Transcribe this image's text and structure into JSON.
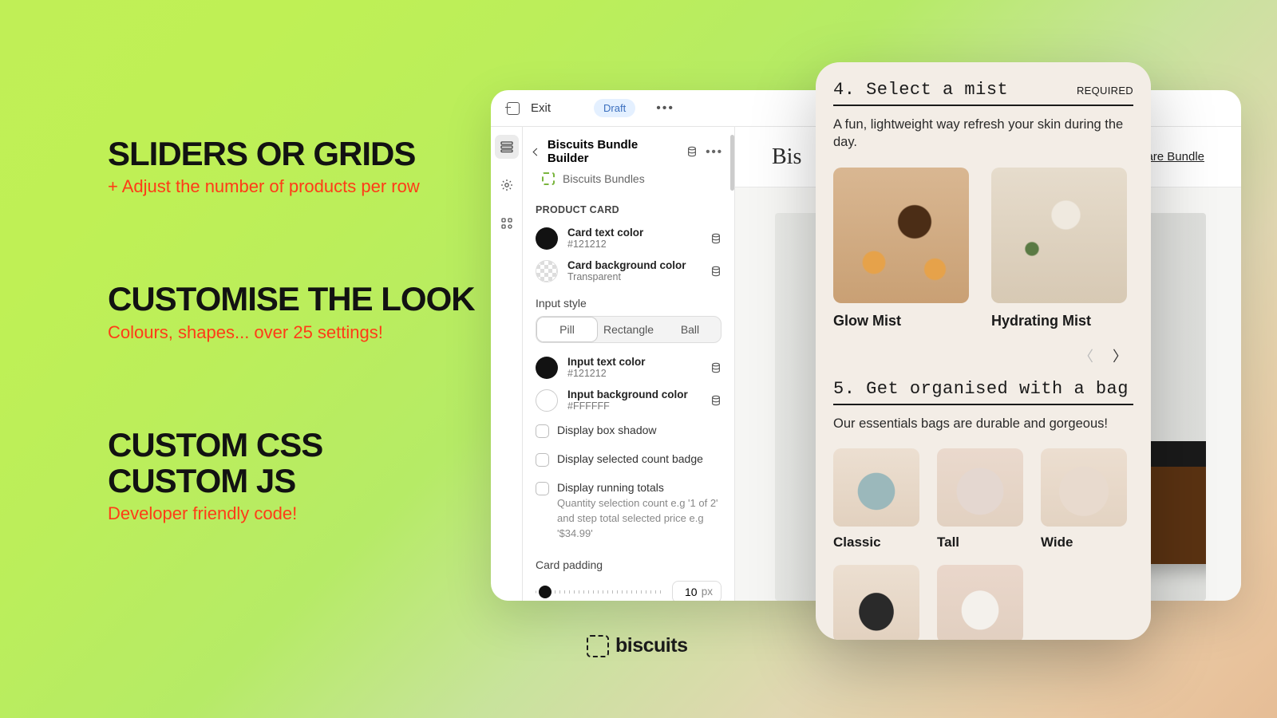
{
  "headlines": [
    {
      "title": "SLIDERS OR GRIDS",
      "sub": "+ Adjust the number of products per row"
    },
    {
      "title": "CUSTOMISE THE LOOK",
      "sub": "Colours, shapes... over 25 settings!"
    },
    {
      "title": "CUSTOM CSS\nCUSTOM JS",
      "sub": "Developer friendly code!"
    }
  ],
  "editor": {
    "exit": "Exit",
    "status": "Draft",
    "breadcrumb": "Biscuits Bundle Builder",
    "app": "Biscuits Bundles",
    "section": "PRODUCT CARD",
    "cardTextColor": {
      "name": "Card text color",
      "val": "#121212"
    },
    "cardBgColor": {
      "name": "Card background color",
      "val": "Transparent"
    },
    "inputStyle": {
      "label": "Input style",
      "options": [
        "Pill",
        "Rectangle",
        "Ball"
      ],
      "active": "Pill"
    },
    "inputTextColor": {
      "name": "Input text color",
      "val": "#121212"
    },
    "inputBgColor": {
      "name": "Input background color",
      "val": "#FFFFFF"
    },
    "checks": {
      "shadow": "Display box shadow",
      "badge": "Display selected count badge",
      "totals": "Display running totals",
      "totalsDesc": "Quantity selection count e.g '1 of 2' and step total selected price e.g '$34.99'"
    },
    "padding": {
      "label": "Card padding",
      "value": "10",
      "unit": "px"
    }
  },
  "preview": {
    "brand": "Bis",
    "nav": "Skincare Bundle"
  },
  "mobile": {
    "step4": {
      "num": "4.",
      "title": "Select a mist",
      "required": "REQUIRED",
      "blurb": "A fun, lightweight way refresh your skin during the day.",
      "items": [
        "Glow Mist",
        "Hydrating Mist"
      ]
    },
    "step5": {
      "num": "5.",
      "title": "Get organised with a bag",
      "blurb": "Our essentials bags are durable and gorgeous!",
      "items": [
        "Classic",
        "Tall",
        "Wide"
      ]
    }
  },
  "brand": "biscuits"
}
